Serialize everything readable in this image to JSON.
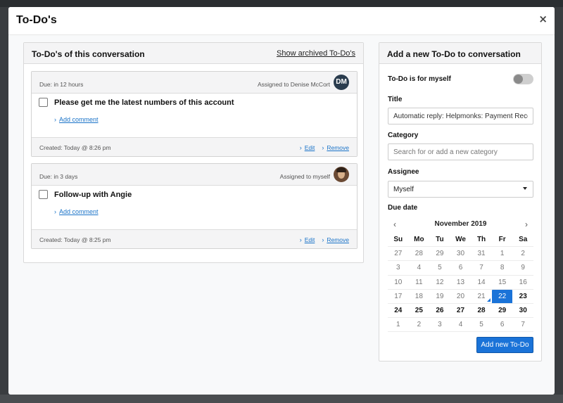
{
  "modal": {
    "title": "To-Do's",
    "close_glyph": "×"
  },
  "left": {
    "title": "To-Do's of this conversation",
    "archived_link": "Show archived To-Do's",
    "todos": [
      {
        "due": "Due: in 12 hours",
        "assigned": "Assigned to Denise McCort",
        "avatar_initials": "DM",
        "text": "Please get me the latest numbers of this account",
        "add_comment": "Add comment",
        "created": "Created: Today @ 8:26 pm",
        "edit": "Edit",
        "remove": "Remove"
      },
      {
        "due": "Due: in 3 days",
        "assigned": "Assigned to myself",
        "avatar_initials": "",
        "text": "Follow-up with Angie",
        "add_comment": "Add comment",
        "created": "Created: Today @ 8:25 pm",
        "edit": "Edit",
        "remove": "Remove"
      }
    ]
  },
  "right": {
    "title": "Add a new To-Do to conversation",
    "myself_label": "To-Do is for myself",
    "myself_toggle_on": false,
    "title_label": "Title",
    "title_value": "Automatic reply: Helpmonks: Payment Receipt",
    "category_label": "Category",
    "category_placeholder": "Search for or add a new category",
    "assignee_label": "Assignee",
    "assignee_value": "Myself",
    "due_label": "Due date",
    "calendar": {
      "month": "November 2019",
      "prev": "‹",
      "next": "›",
      "weekdays": [
        "Su",
        "Mo",
        "Tu",
        "We",
        "Th",
        "Fr",
        "Sa"
      ],
      "weeks": [
        [
          "27",
          "28",
          "29",
          "30",
          "31",
          "1",
          "2"
        ],
        [
          "3",
          "4",
          "5",
          "6",
          "7",
          "8",
          "9"
        ],
        [
          "10",
          "11",
          "12",
          "13",
          "14",
          "15",
          "16"
        ],
        [
          "17",
          "18",
          "19",
          "20",
          "21",
          "22",
          "23"
        ],
        [
          "24",
          "25",
          "26",
          "27",
          "28",
          "29",
          "30"
        ],
        [
          "1",
          "2",
          "3",
          "4",
          "5",
          "6",
          "7"
        ]
      ],
      "selected_day": "22",
      "today_day": "21"
    },
    "submit": "Add new To-Do"
  },
  "colors": {
    "accent": "#1a73d8",
    "link": "#1a73c8"
  },
  "icons": {
    "chevron": "›"
  }
}
